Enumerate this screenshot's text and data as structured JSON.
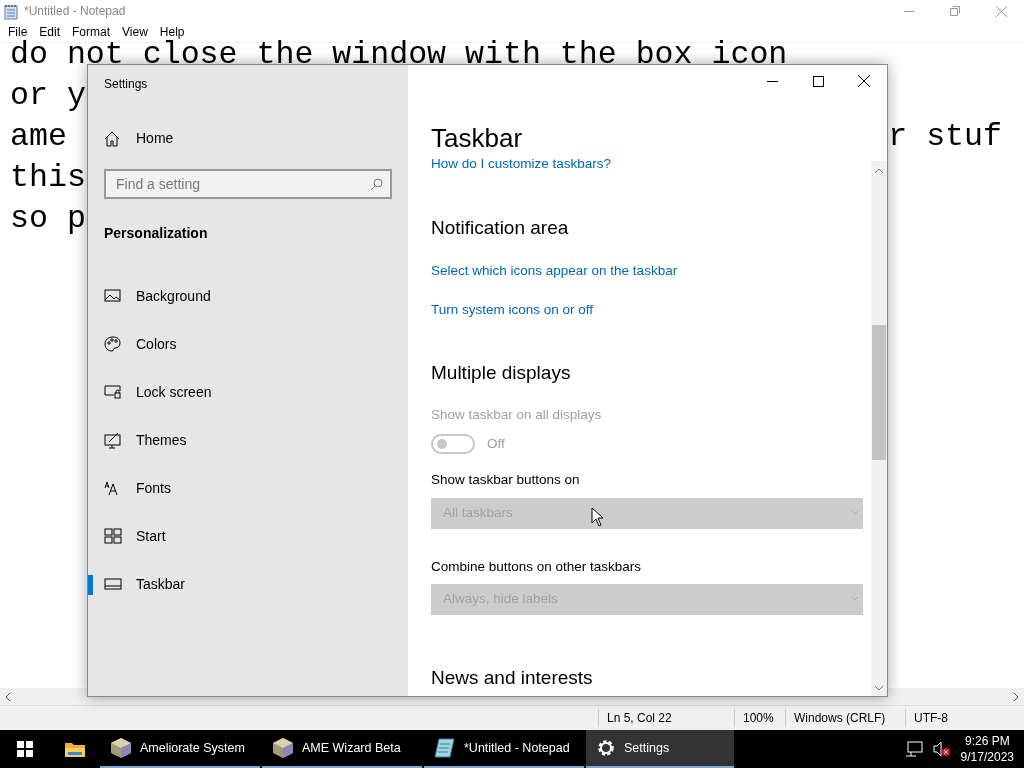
{
  "notepad": {
    "title": "*Untitled - Notepad",
    "menu": [
      "File",
      "Edit",
      "Format",
      "View",
      "Help"
    ],
    "lines": [
      {
        "left": "do not close the window with the box icon"
      },
      {
        "left": "or y"
      },
      {
        "left": "ame",
        "right": "r stuf"
      },
      {
        "left": "this"
      },
      {
        "left": "so p"
      }
    ],
    "status_bar": [
      "Ln 5, Col 22",
      "100%",
      "Windows (CRLF)",
      "UTF-8"
    ]
  },
  "settings": {
    "title": "Settings",
    "sidebar": {
      "home": "Home",
      "search": {
        "placeholder": "Find a setting"
      },
      "section": "Personalization",
      "items": [
        {
          "label": "Background",
          "selected": false
        },
        {
          "label": "Colors",
          "selected": false
        },
        {
          "label": "Lock screen",
          "selected": false
        },
        {
          "label": "Themes",
          "selected": false
        },
        {
          "label": "Fonts",
          "selected": false
        },
        {
          "label": "Start",
          "selected": false
        },
        {
          "label": "Taskbar",
          "selected": true
        }
      ]
    },
    "content": {
      "title": "Taskbar",
      "items": [
        {
          "kind": "link",
          "text": "How do I customize taskbars?"
        },
        {
          "kind": "heading",
          "text": "Notification area"
        },
        {
          "kind": "link",
          "text": "Select which icons appear on the taskbar"
        },
        {
          "kind": "link",
          "text": "Turn system icons on or off"
        },
        {
          "kind": "heading",
          "text": "Multiple displays"
        },
        {
          "kind": "label",
          "text": "Show taskbar on all displays",
          "disabled": true
        },
        {
          "kind": "toggle",
          "text": "Off",
          "on": false,
          "disabled": true
        },
        {
          "kind": "label",
          "text": "Show taskbar buttons on",
          "disabled": false
        },
        {
          "kind": "dropdown",
          "value": "All taskbars",
          "disabled": true
        },
        {
          "kind": "label",
          "text": "Combine buttons on other taskbars",
          "disabled": false
        },
        {
          "kind": "dropdown",
          "value": "Always, hide labels",
          "disabled": true
        },
        {
          "kind": "heading",
          "text": "News and interests"
        }
      ]
    }
  },
  "taskbar": {
    "apps": [
      {
        "label": "Ameliorate System",
        "selected": false
      },
      {
        "label": "AME Wizard Beta",
        "selected": false
      },
      {
        "label": "*Untitled - Notepad",
        "selected": false
      },
      {
        "label": "Settings",
        "selected": true
      }
    ],
    "time": "9:26 PM",
    "date": "9/17/2023"
  }
}
